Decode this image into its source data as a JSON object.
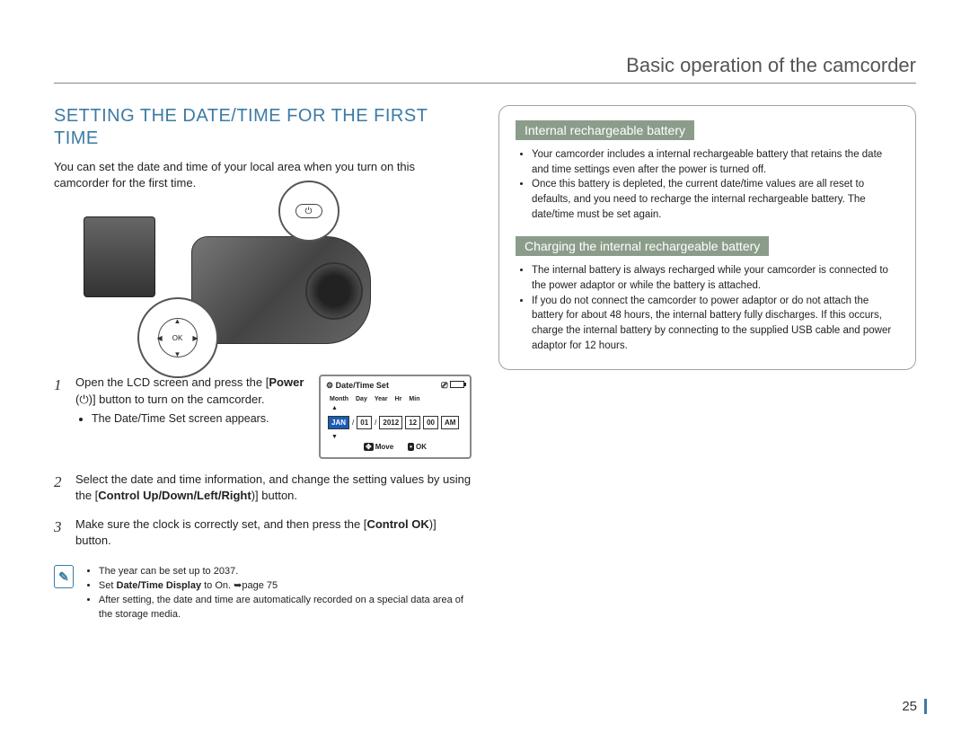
{
  "header": {
    "title": "Basic operation of the camcorder"
  },
  "left": {
    "section_title": "SETTING THE DATE/TIME FOR THE FIRST TIME",
    "intro": "You can set the date and time of your local area when you turn on this camcorder for the first time.",
    "steps": [
      {
        "num": "1",
        "text_a": "Open the LCD screen and press the [",
        "text_b": "Power",
        "text_c": " (⏻)] button to turn on the camcorder.",
        "sub": [
          "The Date/Time Set screen appears."
        ]
      },
      {
        "num": "2",
        "text_a": "Select the date and time information, and change the setting values by using the [",
        "text_b": "Control Up/Down/Left/Right",
        "text_c": ")] button."
      },
      {
        "num": "3",
        "text_a": "Make sure the clock is correctly set, and then press the [",
        "text_b": "Control OK",
        "text_c": ")] button."
      }
    ],
    "lcd": {
      "title": "Date/Time Set",
      "labels": [
        "Month",
        "Day",
        "Year",
        "Hr",
        "Min"
      ],
      "values": [
        "JAN",
        "01",
        "2012",
        "12",
        "00",
        "AM"
      ],
      "move": "Move",
      "ok": "OK"
    },
    "notes": [
      "The year can be set up to 2037.",
      "Set Date/Time Display to On. ➥page 75",
      "After setting, the date and time are automatically recorded on a special data area of the storage media."
    ],
    "note_bold": "Date/Time Display"
  },
  "right": {
    "sub1": {
      "title": "Internal rechargeable battery",
      "items": [
        "Your camcorder includes a internal rechargeable battery that retains the date and time settings even after the power is turned off.",
        "Once this battery is depleted, the current date/time values are all reset to defaults, and you need to recharge the internal rechargeable battery. The date/time must be set again."
      ]
    },
    "sub2": {
      "title": "Charging the internal rechargeable battery",
      "items": [
        "The internal battery is always recharged while your camcorder is connected to the power adaptor or while the battery is attached.",
        "If you do not connect the camcorder to power adaptor or do not attach the battery for about 48 hours, the internal battery fully discharges. If this occurs, charge the internal battery by connecting to the supplied USB cable and power adaptor for 12 hours."
      ]
    }
  },
  "page_number": "25",
  "icons": {
    "ok_label": "OK"
  }
}
